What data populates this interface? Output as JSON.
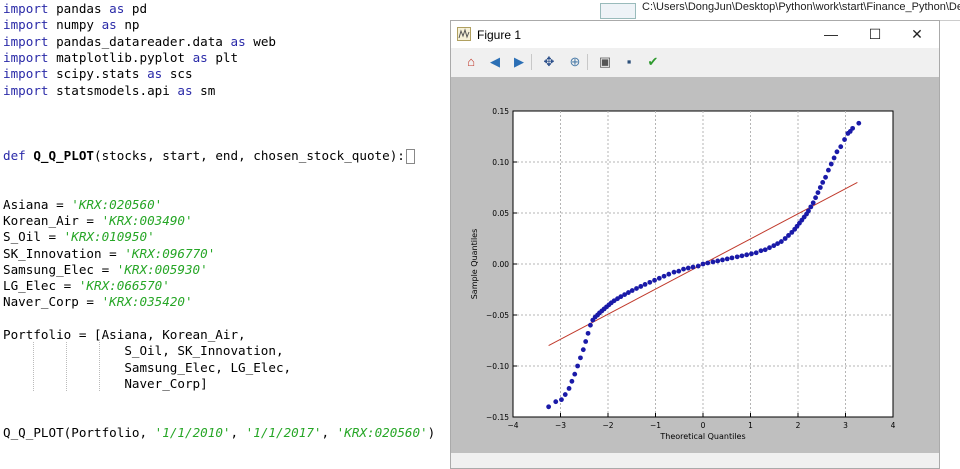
{
  "editor": {
    "lines": [
      [
        {
          "t": "import",
          "c": "kw"
        },
        {
          "t": " pandas "
        },
        {
          "t": "as",
          "c": "kw"
        },
        {
          "t": " pd"
        }
      ],
      [
        {
          "t": "import",
          "c": "kw"
        },
        {
          "t": " numpy "
        },
        {
          "t": "as",
          "c": "kw"
        },
        {
          "t": " np"
        }
      ],
      [
        {
          "t": "import",
          "c": "kw"
        },
        {
          "t": " pandas_datareader.data "
        },
        {
          "t": "as",
          "c": "kw"
        },
        {
          "t": " web"
        }
      ],
      [
        {
          "t": "import",
          "c": "kw"
        },
        {
          "t": " matplotlib.pyplot "
        },
        {
          "t": "as",
          "c": "kw"
        },
        {
          "t": " plt"
        }
      ],
      [
        {
          "t": "import",
          "c": "kw"
        },
        {
          "t": " scipy.stats "
        },
        {
          "t": "as",
          "c": "kw"
        },
        {
          "t": " scs"
        }
      ],
      [
        {
          "t": "import",
          "c": "kw"
        },
        {
          "t": " statsmodels.api "
        },
        {
          "t": "as",
          "c": "kw"
        },
        {
          "t": " sm"
        }
      ],
      [],
      [],
      [],
      [
        {
          "t": "def",
          "c": "kw"
        },
        {
          "t": " "
        },
        {
          "t": "Q_Q_PLOT",
          "c": "fn"
        },
        {
          "t": "(stocks, start, end, chosen_stock_quote):"
        },
        {
          "t": "",
          "c": "cursorbox"
        }
      ],
      [],
      [],
      [
        {
          "t": "Asiana = "
        },
        {
          "t": "'KRX:020560'",
          "c": "str"
        }
      ],
      [
        {
          "t": "Korean_Air = "
        },
        {
          "t": "'KRX:003490'",
          "c": "str"
        }
      ],
      [
        {
          "t": "S_Oil = "
        },
        {
          "t": "'KRX:010950'",
          "c": "str"
        }
      ],
      [
        {
          "t": "SK_Innovation = "
        },
        {
          "t": "'KRX:096770'",
          "c": "str"
        }
      ],
      [
        {
          "t": "Samsung_Elec = "
        },
        {
          "t": "'KRX:005930'",
          "c": "str"
        }
      ],
      [
        {
          "t": "LG_Elec = "
        },
        {
          "t": "'KRX:066570'",
          "c": "str"
        }
      ],
      [
        {
          "t": "Naver_Corp = "
        },
        {
          "t": "'KRX:035420'",
          "c": "str"
        }
      ],
      [],
      [
        {
          "t": "Portfolio = [Asiana, Korean_Air,"
        }
      ],
      [
        {
          "t": "                S_Oil, SK_Innovation,"
        }
      ],
      [
        {
          "t": "                Samsung_Elec, LG_Elec,"
        }
      ],
      [
        {
          "t": "                Naver_Corp]"
        }
      ],
      [],
      [],
      [
        {
          "t": "Q_Q_PLOT(Portfolio, "
        },
        {
          "t": "'1/1/2010'",
          "c": "str"
        },
        {
          "t": ", "
        },
        {
          "t": "'1/1/2017'",
          "c": "str"
        },
        {
          "t": ", "
        },
        {
          "t": "'KRX:020560'",
          "c": "str"
        },
        {
          "t": ")"
        }
      ]
    ]
  },
  "explorer": {
    "path": "C:\\Users\\DongJun\\Desktop\\Python\\work\\start\\Finance_Python\\Demo"
  },
  "window": {
    "title": "Figure 1",
    "minimize": "—",
    "maximize": "☐",
    "close": "✕"
  },
  "toolbar": [
    {
      "name": "home-icon",
      "glyph": "⌂",
      "color": "#c0392b"
    },
    {
      "name": "back-icon",
      "glyph": "◀",
      "color": "#2b6fb5"
    },
    {
      "name": "forward-icon",
      "glyph": "▶",
      "color": "#2b6fb5"
    },
    {
      "name": "pan-icon",
      "glyph": "✥",
      "color": "#2b4f8a"
    },
    {
      "name": "zoom-icon",
      "glyph": "⊕",
      "color": "#4a7ba8"
    },
    {
      "name": "subplots-icon",
      "glyph": "▣",
      "color": "#555555"
    },
    {
      "name": "save-icon",
      "glyph": "▪",
      "color": "#2c4f7a"
    },
    {
      "name": "edit-check-icon",
      "glyph": "✔",
      "color": "#2e9a2e"
    }
  ],
  "chart_data": {
    "type": "scatter",
    "title": "",
    "xlabel": "Theoretical Quantiles",
    "ylabel": "Sample Quantiles",
    "xlim": [
      -4,
      4
    ],
    "ylim": [
      -0.15,
      0.15
    ],
    "xticks": [
      "−4",
      "−3",
      "−2",
      "−1",
      "0",
      "1",
      "2",
      "3",
      "4"
    ],
    "yticks": [
      "−0.15",
      "−0.10",
      "−0.05",
      "0.00",
      "0.05",
      "0.10",
      "0.15"
    ],
    "grid": true,
    "marker_color": "#1a1aa8",
    "line_color": "#c0392b",
    "points": [
      [
        -3.25,
        -0.14
      ],
      [
        -3.1,
        -0.135
      ],
      [
        -2.98,
        -0.133
      ],
      [
        -2.9,
        -0.128
      ],
      [
        -2.82,
        -0.122
      ],
      [
        -2.76,
        -0.115
      ],
      [
        -2.7,
        -0.108
      ],
      [
        -2.64,
        -0.1
      ],
      [
        -2.58,
        -0.092
      ],
      [
        -2.52,
        -0.084
      ],
      [
        -2.47,
        -0.076
      ],
      [
        -2.42,
        -0.068
      ],
      [
        -2.37,
        -0.06
      ],
      [
        -2.32,
        -0.055
      ],
      [
        -2.27,
        -0.052
      ],
      [
        -2.22,
        -0.05
      ],
      [
        -2.18,
        -0.048
      ],
      [
        -2.13,
        -0.046
      ],
      [
        -2.08,
        -0.044
      ],
      [
        -2.03,
        -0.042
      ],
      [
        -1.98,
        -0.04
      ],
      [
        -1.93,
        -0.038
      ],
      [
        -1.87,
        -0.036
      ],
      [
        -1.8,
        -0.034
      ],
      [
        -1.73,
        -0.032
      ],
      [
        -1.65,
        -0.03
      ],
      [
        -1.57,
        -0.028
      ],
      [
        -1.49,
        -0.026
      ],
      [
        -1.4,
        -0.024
      ],
      [
        -1.31,
        -0.022
      ],
      [
        -1.22,
        -0.02
      ],
      [
        -1.12,
        -0.018
      ],
      [
        -1.02,
        -0.016
      ],
      [
        -0.92,
        -0.014
      ],
      [
        -0.82,
        -0.012
      ],
      [
        -0.72,
        -0.01
      ],
      [
        -0.61,
        -0.008
      ],
      [
        -0.51,
        -0.007
      ],
      [
        -0.41,
        -0.005
      ],
      [
        -0.31,
        -0.004
      ],
      [
        -0.21,
        -0.003
      ],
      [
        -0.1,
        -0.002
      ],
      [
        0.0,
        0.0
      ],
      [
        0.1,
        0.001
      ],
      [
        0.21,
        0.002
      ],
      [
        0.31,
        0.003
      ],
      [
        0.41,
        0.004
      ],
      [
        0.51,
        0.005
      ],
      [
        0.61,
        0.006
      ],
      [
        0.72,
        0.007
      ],
      [
        0.82,
        0.008
      ],
      [
        0.92,
        0.009
      ],
      [
        1.02,
        0.01
      ],
      [
        1.12,
        0.011
      ],
      [
        1.22,
        0.013
      ],
      [
        1.31,
        0.014
      ],
      [
        1.4,
        0.016
      ],
      [
        1.49,
        0.018
      ],
      [
        1.57,
        0.02
      ],
      [
        1.65,
        0.022
      ],
      [
        1.73,
        0.025
      ],
      [
        1.8,
        0.028
      ],
      [
        1.87,
        0.031
      ],
      [
        1.93,
        0.034
      ],
      [
        1.98,
        0.037
      ],
      [
        2.03,
        0.04
      ],
      [
        2.08,
        0.043
      ],
      [
        2.13,
        0.046
      ],
      [
        2.18,
        0.049
      ],
      [
        2.22,
        0.052
      ],
      [
        2.27,
        0.056
      ],
      [
        2.32,
        0.06
      ],
      [
        2.37,
        0.065
      ],
      [
        2.42,
        0.07
      ],
      [
        2.47,
        0.075
      ],
      [
        2.52,
        0.08
      ],
      [
        2.58,
        0.085
      ],
      [
        2.64,
        0.092
      ],
      [
        2.7,
        0.098
      ],
      [
        2.76,
        0.104
      ],
      [
        2.82,
        0.11
      ],
      [
        2.9,
        0.115
      ],
      [
        2.98,
        0.122
      ],
      [
        3.05,
        0.128
      ],
      [
        3.1,
        0.13
      ],
      [
        3.15,
        0.133
      ],
      [
        3.28,
        0.138
      ]
    ],
    "reference_line": [
      [
        -3.25,
        -0.08
      ],
      [
        3.25,
        0.08
      ]
    ]
  }
}
